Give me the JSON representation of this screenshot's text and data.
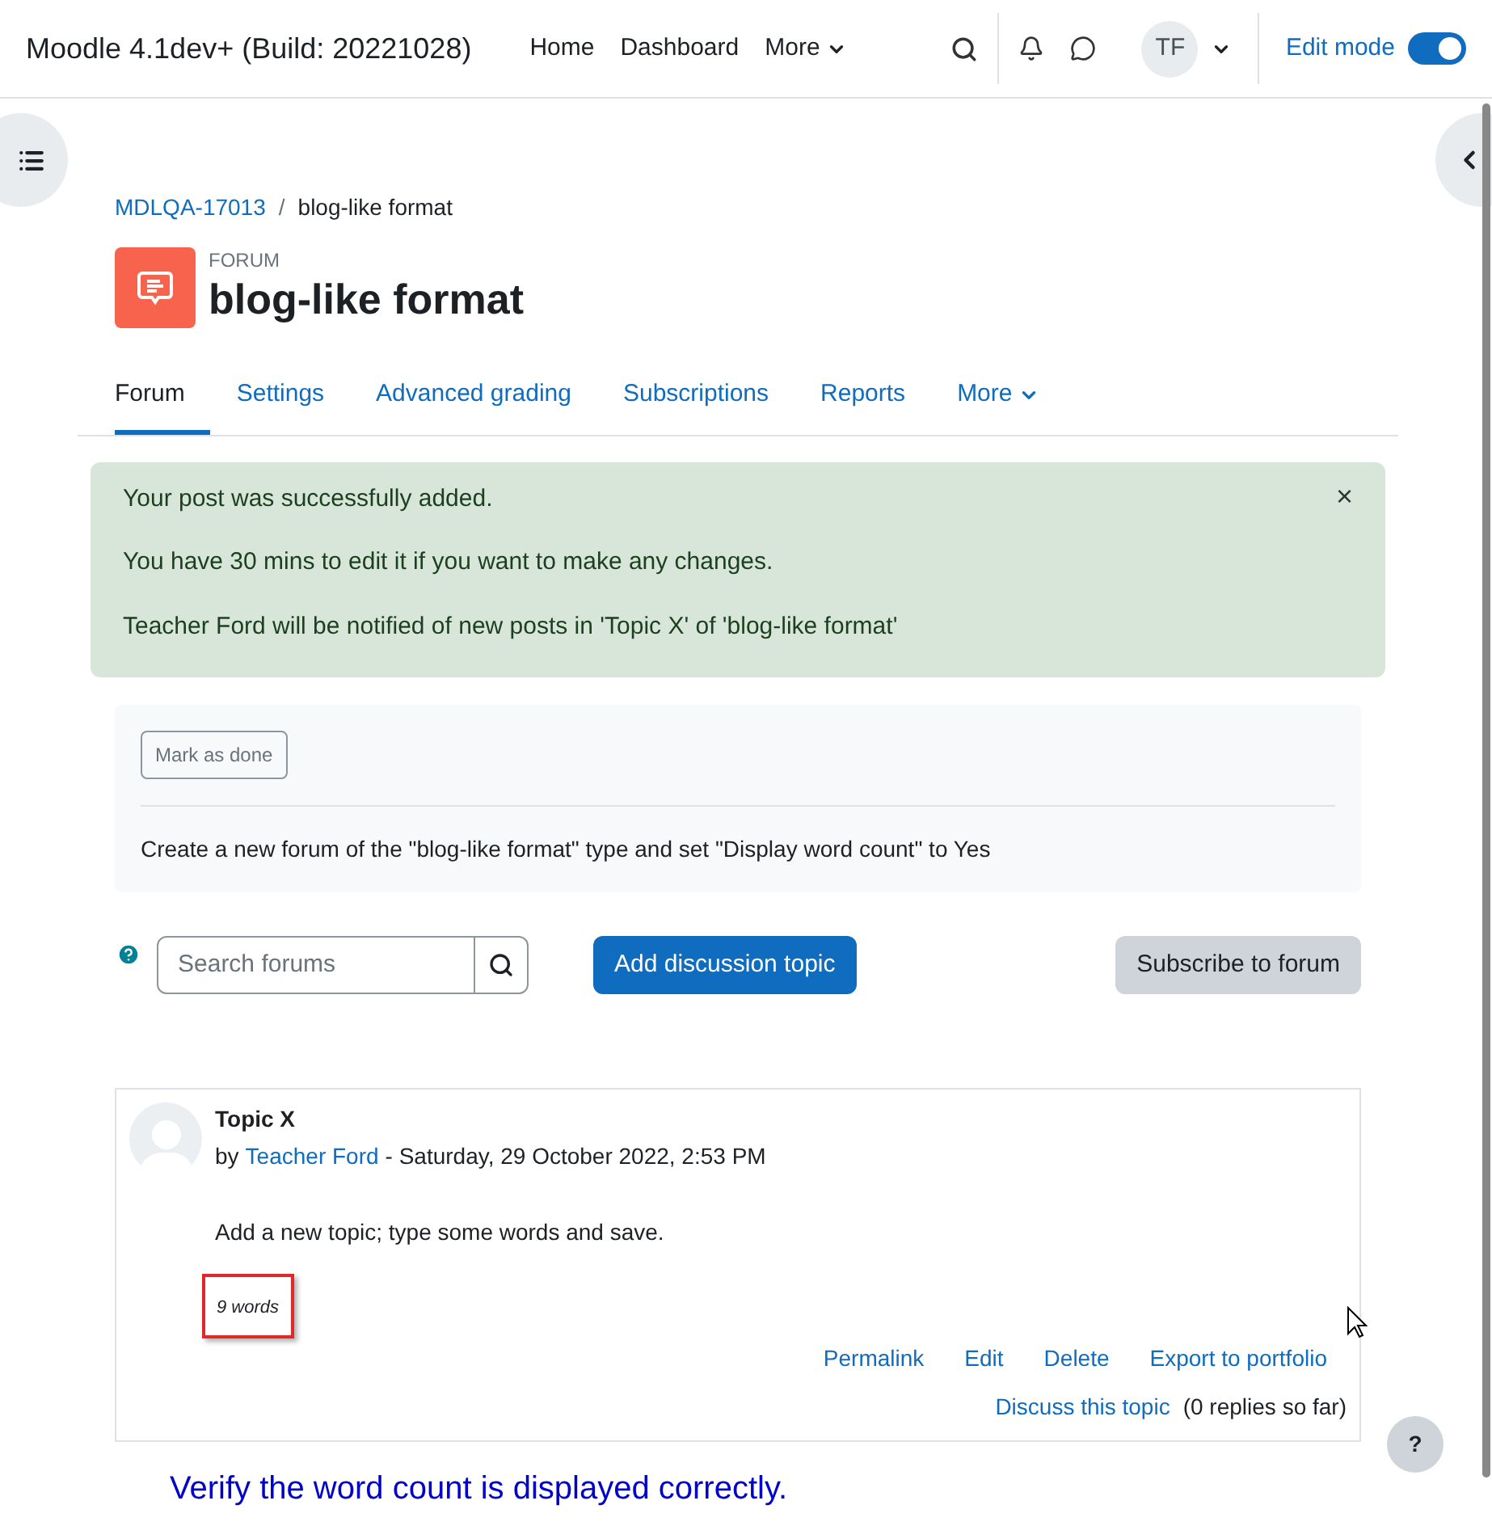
{
  "navbar": {
    "site_name": "Moodle 4.1dev+ (Build: 20221028)",
    "links": [
      {
        "label": "Home",
        "kind": "link"
      },
      {
        "label": "Dashboard",
        "kind": "link"
      },
      {
        "label": "More",
        "kind": "menu"
      }
    ],
    "user_initials": "TF",
    "edit_mode": {
      "label": "Edit mode",
      "on": true
    }
  },
  "breadcrumb_separator": "/",
  "breadcrumb": [
    {
      "label": "MDLQA-17013",
      "kind": "link"
    },
    {
      "label": "blog-like format",
      "kind": "current"
    }
  ],
  "header": {
    "module_type": "FORUM",
    "title": "blog-like format"
  },
  "tabs": [
    {
      "label": "Forum",
      "selected": true,
      "kind": "tab"
    },
    {
      "label": "Settings",
      "selected": false,
      "kind": "tab"
    },
    {
      "label": "Advanced grading",
      "selected": false,
      "kind": "tab"
    },
    {
      "label": "Subscriptions",
      "selected": false,
      "kind": "tab"
    },
    {
      "label": "Reports",
      "selected": false,
      "kind": "tab"
    },
    {
      "label": "More",
      "selected": false,
      "kind": "menu"
    }
  ],
  "alert": {
    "lines": [
      "Your post was successfully added.",
      "You have 30 mins to edit it if you want to make any changes.",
      "Teacher Ford will be notified of new posts in 'Topic X' of 'blog-like format'"
    ],
    "close": "×"
  },
  "completion": {
    "button": "Mark as done",
    "description": "Create a new forum of the \"blog-like format\" type and set \"Display word count\" to Yes"
  },
  "search": {
    "placeholder": "Search forums"
  },
  "add_button": "Add discussion topic",
  "subscribe_button": "Subscribe to forum",
  "post": {
    "subject": "Topic X",
    "by": "by",
    "author": "Teacher Ford",
    "date": "- Saturday, 29 October 2022, 2:53 PM",
    "message": "Add a new topic; type some words and save.",
    "word_count": "9 words",
    "word_count_highlighted": true,
    "actions": [
      "Permalink",
      "Edit",
      "Delete",
      "Export to portfolio"
    ],
    "discuss": "Discuss this topic",
    "replies": "(0 replies so far)"
  },
  "help_button": "?",
  "annotation": "Verify the word count is displayed correctly."
}
